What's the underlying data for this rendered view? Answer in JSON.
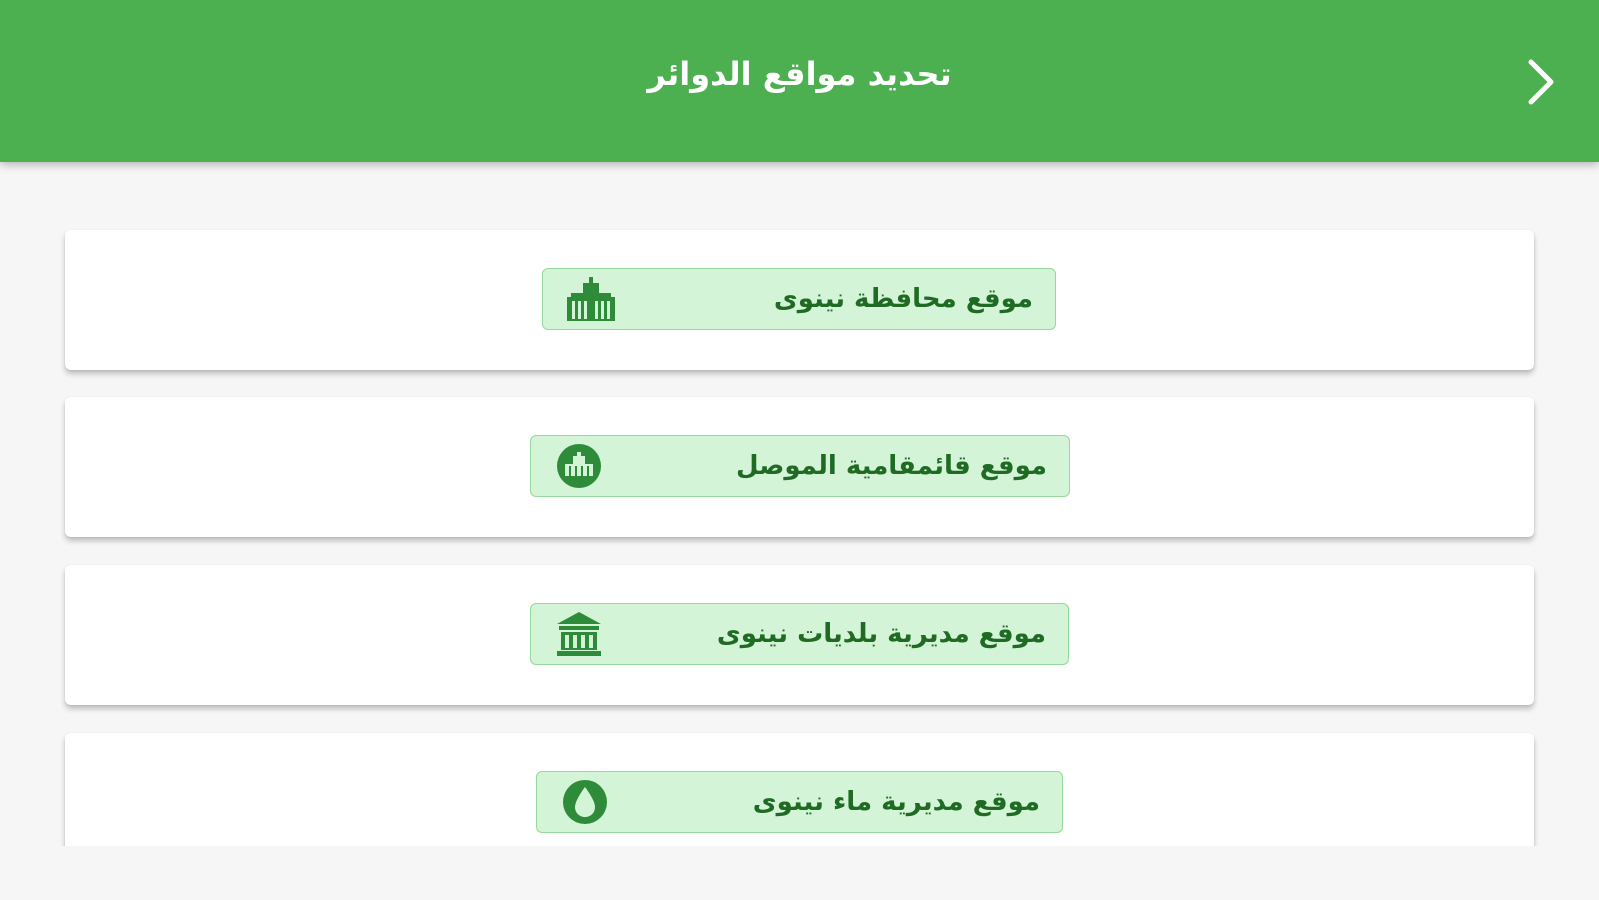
{
  "header": {
    "title": "تحديد مواقع الدوائر",
    "back_icon": "chevron-right-icon"
  },
  "colors": {
    "header_bg": "#4caf50",
    "page_bg": "#f6f6f6",
    "pill_bg": "#d3f4d6",
    "pill_border": "#95d89b",
    "pill_text": "#1f6b24",
    "icon_color": "#2e8b3a"
  },
  "locations": [
    {
      "label": "موقع محافظة نينوى",
      "icon": "government-building-icon"
    },
    {
      "label": "موقع قائمقامية الموصل",
      "icon": "circle-building-icon"
    },
    {
      "label": "موقع مديرية بلديات نينوى",
      "icon": "municipality-building-icon"
    },
    {
      "label": "موقع مديرية ماء نينوى",
      "icon": "water-drop-icon"
    }
  ]
}
